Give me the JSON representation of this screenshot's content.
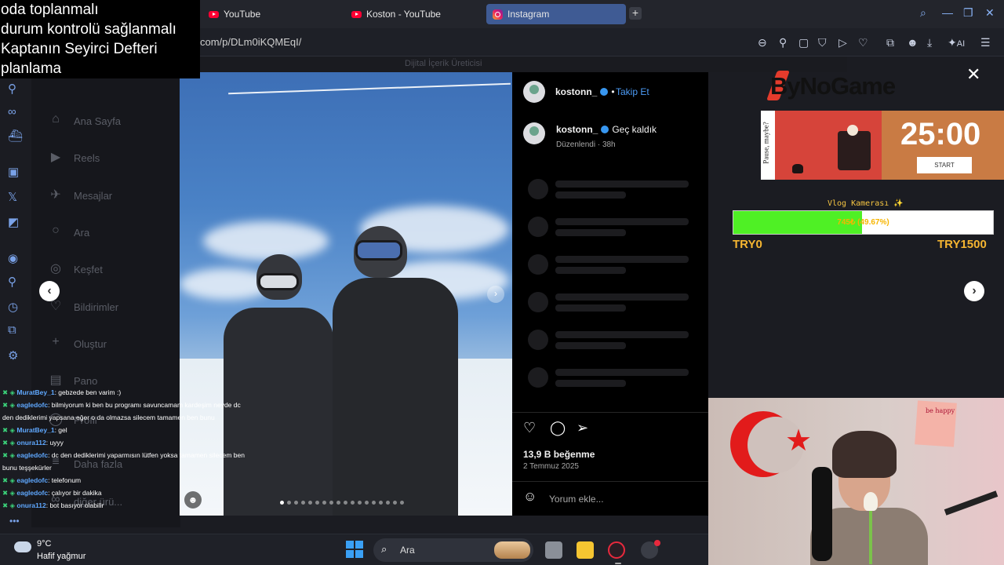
{
  "overlay_notes": [
    "oda toplanmalı",
    "durum kontrolü sağlanmalı",
    "Kaptanın Seyirci Defteri",
    "planlama"
  ],
  "tabs": [
    {
      "label": "YouTube",
      "icon": "youtube-icon"
    },
    {
      "label": "Koston - YouTube",
      "icon": "youtube-icon"
    },
    {
      "label": "Instagram",
      "icon": "instagram-icon",
      "active": true
    }
  ],
  "address": {
    "url": "com/p/DLm0iKQMEqI/"
  },
  "toolbar": {
    "ai_label": "AI"
  },
  "ig_nav": {
    "items": [
      {
        "label": "Ana Sayfa",
        "icon": "home-icon"
      },
      {
        "label": "Reels",
        "icon": "reels-icon"
      },
      {
        "label": "Mesajlar",
        "icon": "messages-icon"
      },
      {
        "label": "Ara",
        "icon": "search-icon"
      },
      {
        "label": "Keşfet",
        "icon": "explore-icon"
      },
      {
        "label": "Bildirimler",
        "icon": "heart-icon"
      },
      {
        "label": "Oluştur",
        "icon": "plus-icon"
      },
      {
        "label": "Pano",
        "icon": "dashboard-icon"
      },
      {
        "label": "Profil",
        "icon": "profile-icon"
      },
      {
        "label": "Daha fazla",
        "icon": "menu-icon"
      },
      {
        "label": "diğer ürü...",
        "icon": "meta-icon"
      }
    ]
  },
  "dim_header": {
    "subtitle": "Dijital İçerik Üreticisi"
  },
  "post": {
    "username": "kostonn_",
    "follow_label": "Takip Et",
    "separator": "•",
    "caption": "Geç kaldık",
    "edited": "Düzenlendi",
    "age": "38h",
    "likes": "13,9 B beğenme",
    "date": "2 Temmuz 2025",
    "comment_placeholder": "Yorum ekle..."
  },
  "brand": {
    "name": "ByNoGame"
  },
  "timer": {
    "time": "25:00",
    "start_label": "START",
    "side_text": "Pause, maybe?"
  },
  "goal": {
    "title": "Vlog Kamerası ✨",
    "progress_text": "745₺ (49.67%)",
    "progress_fraction": 0.4967,
    "min_label": "TRY0",
    "max_label": "TRY1500",
    "fill_color": "#4ff025"
  },
  "chat": [
    {
      "user": "MuratBey_1",
      "msg": ": gebzede ben varim :)"
    },
    {
      "user": "eagledofc",
      "msg": ": bilmiyorum ki ben bu programı savuncamam kardeşim neyde dc"
    },
    {
      "user": "",
      "msg": "den dediklerimi yapsana eğer o da olmazsa silecem tamamen ben bunu"
    },
    {
      "user": "MuratBey_1",
      "msg": ": gel"
    },
    {
      "user": "onura112",
      "msg": ": uyyy"
    },
    {
      "user": "eagledofc",
      "msg": ": dc den dediklerimi yaparmısın lütfen yoksa tamamen silecem ben"
    },
    {
      "user": "",
      "msg": "bunu teşşekürler"
    },
    {
      "user": "eagledofc",
      "msg": ": telefonum"
    },
    {
      "user": "eagledofc",
      "msg": ": çalıyor bir dakika"
    },
    {
      "user": "onura112",
      "msg": ": bot basıyor olabilir"
    }
  ],
  "webcam": {
    "sticky_text": "be happy"
  },
  "taskbar": {
    "temp": "9°C",
    "weather": "Hafif yağmur",
    "search_label": "Ara"
  },
  "colors": {
    "accent": "#3f5b94",
    "link": "#4c9bf5",
    "goal_text": "#f5b531"
  }
}
